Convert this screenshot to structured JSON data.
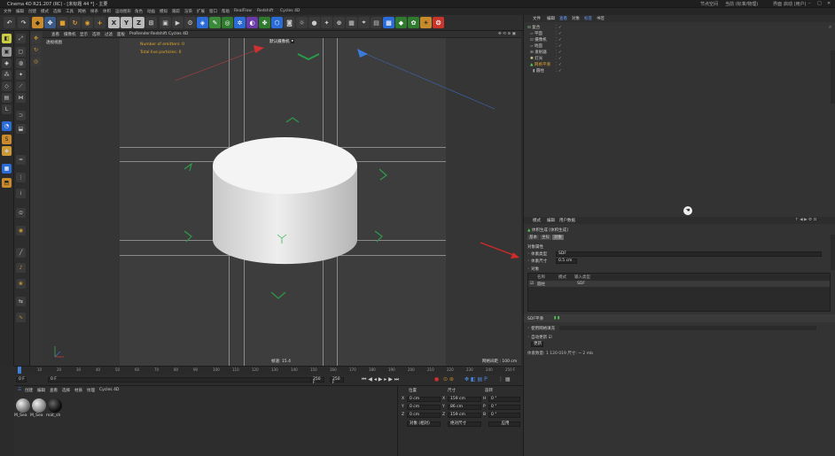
{
  "window": {
    "title": "Cinema 4D R21.207 (RC) - [未标题 44 *] - 主要",
    "right_menu": "节点空间",
    "right_combo": "当前 (标准/物理)",
    "layout_label": "界面",
    "layout_value": "启动 (用户)"
  },
  "menu": [
    "文件",
    "编辑",
    "创建",
    "模式",
    "选择",
    "工具",
    "网格",
    "样条",
    "体积",
    "运动图形",
    "角色",
    "动画",
    "模拟",
    "跟踪",
    "渲染",
    "扩展",
    "窗口",
    "帮助",
    "RealFlow",
    "Redshift",
    "Cycles 4D",
    "RealFlow"
  ],
  "viewport": {
    "menu": [
      "查看",
      "摄像机",
      "显示",
      "选项",
      "过滤",
      "面板",
      "ProRender",
      "Redshift",
      "Cycles 4D"
    ],
    "label": "透视视图",
    "camera": "默认摄像机",
    "notes": [
      "Number of emitters: 0",
      "Total live particles: 0"
    ],
    "speed": "帧速: 15.4",
    "grid": "网格间距 : 100 cm"
  },
  "timeline": {
    "ticks": [
      "0",
      "10",
      "20",
      "30",
      "40",
      "50",
      "60",
      "70",
      "80",
      "90",
      "100",
      "110",
      "120",
      "130",
      "140",
      "150",
      "160",
      "170",
      "180",
      "190",
      "200",
      "210",
      "220",
      "230",
      "240",
      "250"
    ],
    "end_label": "250 F",
    "current": "0 F",
    "start_field": "0 F",
    "end_field": "250 F",
    "preview_end": "250 F"
  },
  "materials": {
    "menu": [
      "创建",
      "编辑",
      "查看",
      "选择",
      "材质",
      "纹理",
      "Cycles 4D"
    ],
    "items": [
      "M_Sea",
      "M_Sea",
      "mat_sh"
    ]
  },
  "coords": {
    "headers": [
      "位置",
      "尺寸",
      "旋转"
    ],
    "rows": [
      {
        "axis": "X",
        "pos": "0 cm",
        "size": "159 cm",
        "rot_label": "H",
        "rot": "0 °"
      },
      {
        "axis": "Y",
        "pos": "0 cm",
        "size": "86 cm",
        "rot_label": "P",
        "rot": "0 °"
      },
      {
        "axis": "Z",
        "pos": "0 cm",
        "size": "159 cm",
        "rot_label": "B",
        "rot": "0 °"
      }
    ],
    "mode1": "对象 (相对)",
    "mode2": "绝对尺寸",
    "apply": "应用"
  },
  "objects": {
    "menu": [
      "文件",
      "编辑",
      "查看",
      "对象",
      "标签",
      "书签"
    ],
    "items": [
      {
        "name": "复合"
      },
      {
        "name": "平面"
      },
      {
        "name": "摄像机"
      },
      {
        "name": "地面"
      },
      {
        "name": "发射器"
      },
      {
        "name": "灯光"
      },
      {
        "name": "网格平滑"
      },
      {
        "name": "圆柱"
      }
    ]
  },
  "attributes": {
    "menu": [
      "模式",
      "编辑",
      "用户数据"
    ],
    "object_title": "体积生成 [体积生成]",
    "tabs": [
      "基本",
      "坐标",
      "对象"
    ],
    "section": "对象属性",
    "volume_type_label": "体素类型",
    "volume_type_value": "SDF",
    "voxel_size_label": "体素尺寸",
    "voxel_size_value": "0.5 cm",
    "objects_label": "对象",
    "table_headers": [
      "名称",
      "模式",
      "输入类型"
    ],
    "table_row": {
      "name": "圆柱",
      "mode": "",
      "type": "SDF"
    },
    "lower_tab": "SDF平滑",
    "opt1": "使用网格填充",
    "opt2": "自动更新",
    "btn": "更新",
    "info": "体素数量: 1 120 019    尺寸: ~ 2 mb"
  }
}
